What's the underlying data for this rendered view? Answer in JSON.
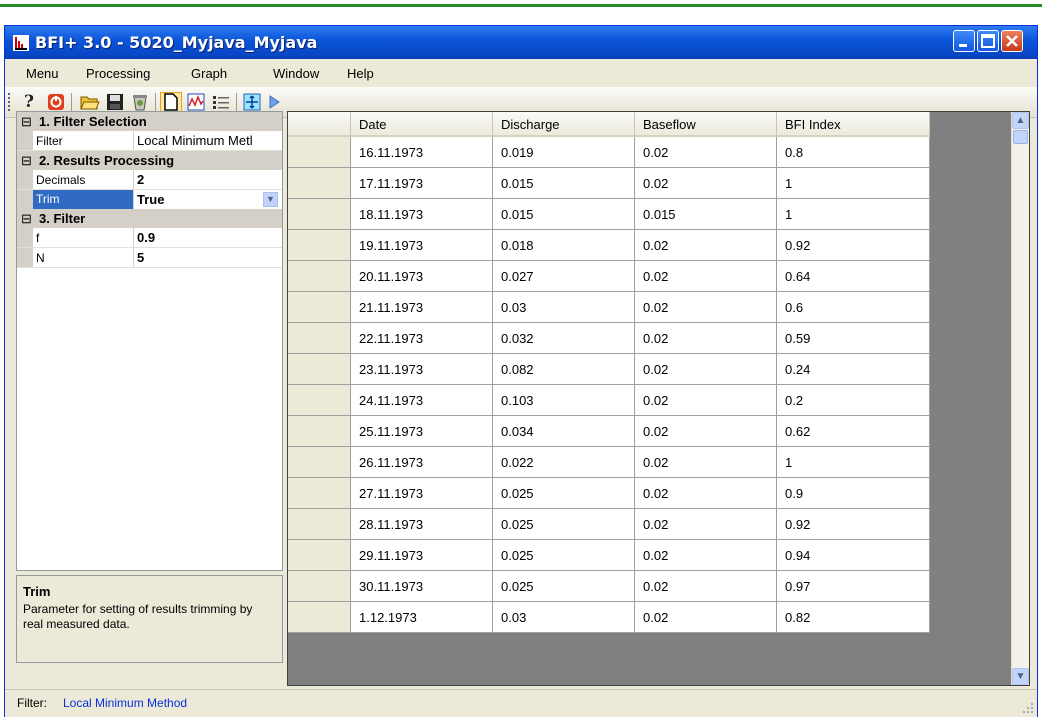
{
  "window": {
    "title": "BFI+ 3.0 - 5020_Myjava_Myjava"
  },
  "menu": [
    "Menu",
    "Processing",
    "Graph",
    "Window",
    "Help"
  ],
  "toolbar": {
    "icons": [
      "help-icon",
      "stop-icon",
      "open-folder-icon",
      "save-icon",
      "recycle-bin-icon",
      "new-document-icon",
      "graph-icon",
      "list-settings-icon",
      "fit-arrows-icon",
      "play-icon"
    ]
  },
  "properties": {
    "categories": [
      {
        "label": "1. Filter Selection",
        "toggle": "⊟",
        "rows": [
          {
            "name": "Filter",
            "value": "Local Minimum Metl"
          }
        ]
      },
      {
        "label": "2. Results Processing",
        "toggle": "⊟",
        "rows": [
          {
            "name": "Decimals",
            "value": "2"
          },
          {
            "name": "Trim",
            "value": "True"
          }
        ]
      },
      {
        "label": "3. Filter",
        "toggle": "⊟",
        "rows": [
          {
            "name": "f",
            "value": "0.9"
          },
          {
            "name": "N",
            "value": "5"
          }
        ]
      }
    ],
    "help": {
      "title": "Trim",
      "description": "Parameter for setting of results trimming by real measured data."
    }
  },
  "table": {
    "columns": [
      "Date",
      "Discharge",
      "Baseflow",
      "BFI Index"
    ],
    "rows": [
      [
        "16.11.1973",
        "0.019",
        "0.02",
        "0.8"
      ],
      [
        "17.11.1973",
        "0.015",
        "0.02",
        "1"
      ],
      [
        "18.11.1973",
        "0.015",
        "0.015",
        "1"
      ],
      [
        "19.11.1973",
        "0.018",
        "0.02",
        "0.92"
      ],
      [
        "20.11.1973",
        "0.027",
        "0.02",
        "0.64"
      ],
      [
        "21.11.1973",
        "0.03",
        "0.02",
        "0.6"
      ],
      [
        "22.11.1973",
        "0.032",
        "0.02",
        "0.59"
      ],
      [
        "23.11.1973",
        "0.082",
        "0.02",
        "0.24"
      ],
      [
        "24.11.1973",
        "0.103",
        "0.02",
        "0.2"
      ],
      [
        "25.11.1973",
        "0.034",
        "0.02",
        "0.62"
      ],
      [
        "26.11.1973",
        "0.022",
        "0.02",
        "1"
      ],
      [
        "27.11.1973",
        "0.025",
        "0.02",
        "0.9"
      ],
      [
        "28.11.1973",
        "0.025",
        "0.02",
        "0.92"
      ],
      [
        "29.11.1973",
        "0.025",
        "0.02",
        "0.94"
      ],
      [
        "30.11.1973",
        "0.025",
        "0.02",
        "0.97"
      ],
      [
        "1.12.1973",
        "0.03",
        "0.02",
        "0.82"
      ]
    ]
  },
  "status": {
    "label": "Filter:",
    "value": "Local Minimum Method"
  },
  "colors": {
    "titlebar": "#0a53d8",
    "selection": "#316ac5",
    "status_value": "#0831d9"
  }
}
